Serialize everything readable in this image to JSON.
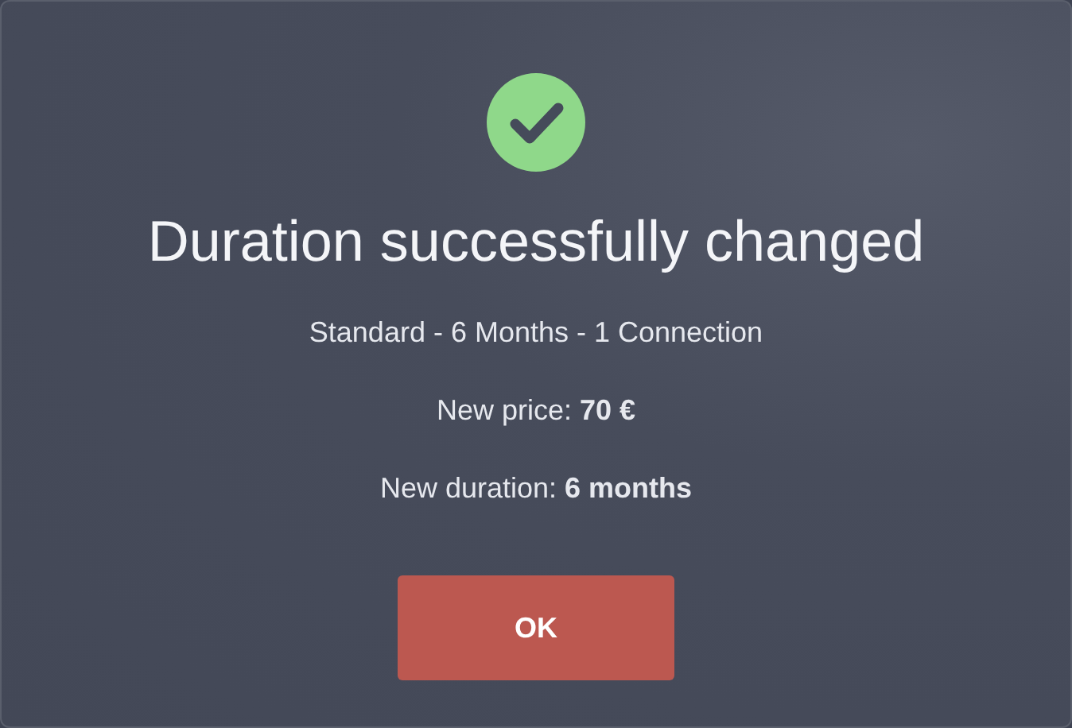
{
  "dialog": {
    "kind": "success",
    "title": "Duration successfully changed",
    "plan": "Standard - 6 Months - 1 Connection",
    "lines": [
      "New price: **70 €**",
      "New duration: **6 months**"
    ],
    "button": "OK"
  }
}
